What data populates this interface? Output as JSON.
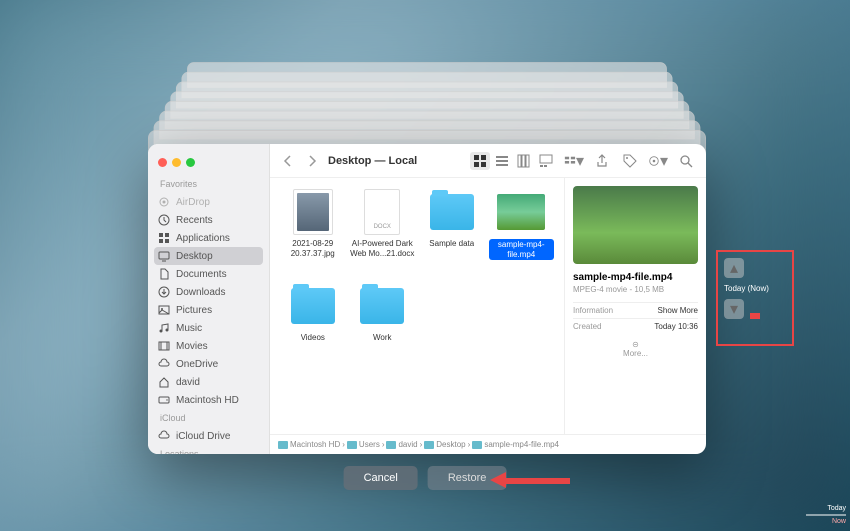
{
  "window": {
    "title": "Desktop — Local"
  },
  "sidebar": {
    "sections": [
      {
        "label": "Favorites",
        "items": [
          {
            "icon": "airdrop",
            "label": "AirDrop",
            "dim": true
          },
          {
            "icon": "recents",
            "label": "Recents"
          },
          {
            "icon": "apps",
            "label": "Applications"
          },
          {
            "icon": "desktop",
            "label": "Desktop",
            "active": true
          },
          {
            "icon": "docs",
            "label": "Documents"
          },
          {
            "icon": "downloads",
            "label": "Downloads"
          },
          {
            "icon": "pictures",
            "label": "Pictures"
          },
          {
            "icon": "music",
            "label": "Music"
          },
          {
            "icon": "movies",
            "label": "Movies"
          },
          {
            "icon": "onedrive",
            "label": "OneDrive"
          },
          {
            "icon": "home",
            "label": "david"
          },
          {
            "icon": "hd",
            "label": "Macintosh HD"
          }
        ]
      },
      {
        "label": "iCloud",
        "items": [
          {
            "icon": "icloud",
            "label": "iCloud Drive"
          }
        ]
      },
      {
        "label": "Locations",
        "items": []
      }
    ]
  },
  "files": [
    {
      "type": "jpg",
      "name": "2021-08-29 20.37.37.jpg"
    },
    {
      "type": "docx",
      "name": "AI-Powered Dark Web Mo...21.docx"
    },
    {
      "type": "folder",
      "name": "Sample data"
    },
    {
      "type": "video",
      "name": "sample-mp4-file.mp4",
      "selected": true
    },
    {
      "type": "folder",
      "name": "Videos"
    },
    {
      "type": "folder",
      "name": "Work"
    }
  ],
  "preview": {
    "filename": "sample-mp4-file.mp4",
    "subtitle": "MPEG-4 movie - 10,5 MB",
    "info_label": "Information",
    "show_more": "Show More",
    "created_label": "Created",
    "created_value": "Today 10:36",
    "more": "More..."
  },
  "pathbar": [
    "Macintosh HD",
    "Users",
    "david",
    "Desktop",
    "sample-mp4-file.mp4"
  ],
  "buttons": {
    "cancel": "Cancel",
    "restore": "Restore"
  },
  "timeline": {
    "label": "Today (Now)"
  },
  "corner": {
    "today": "Today",
    "now": "Now"
  }
}
